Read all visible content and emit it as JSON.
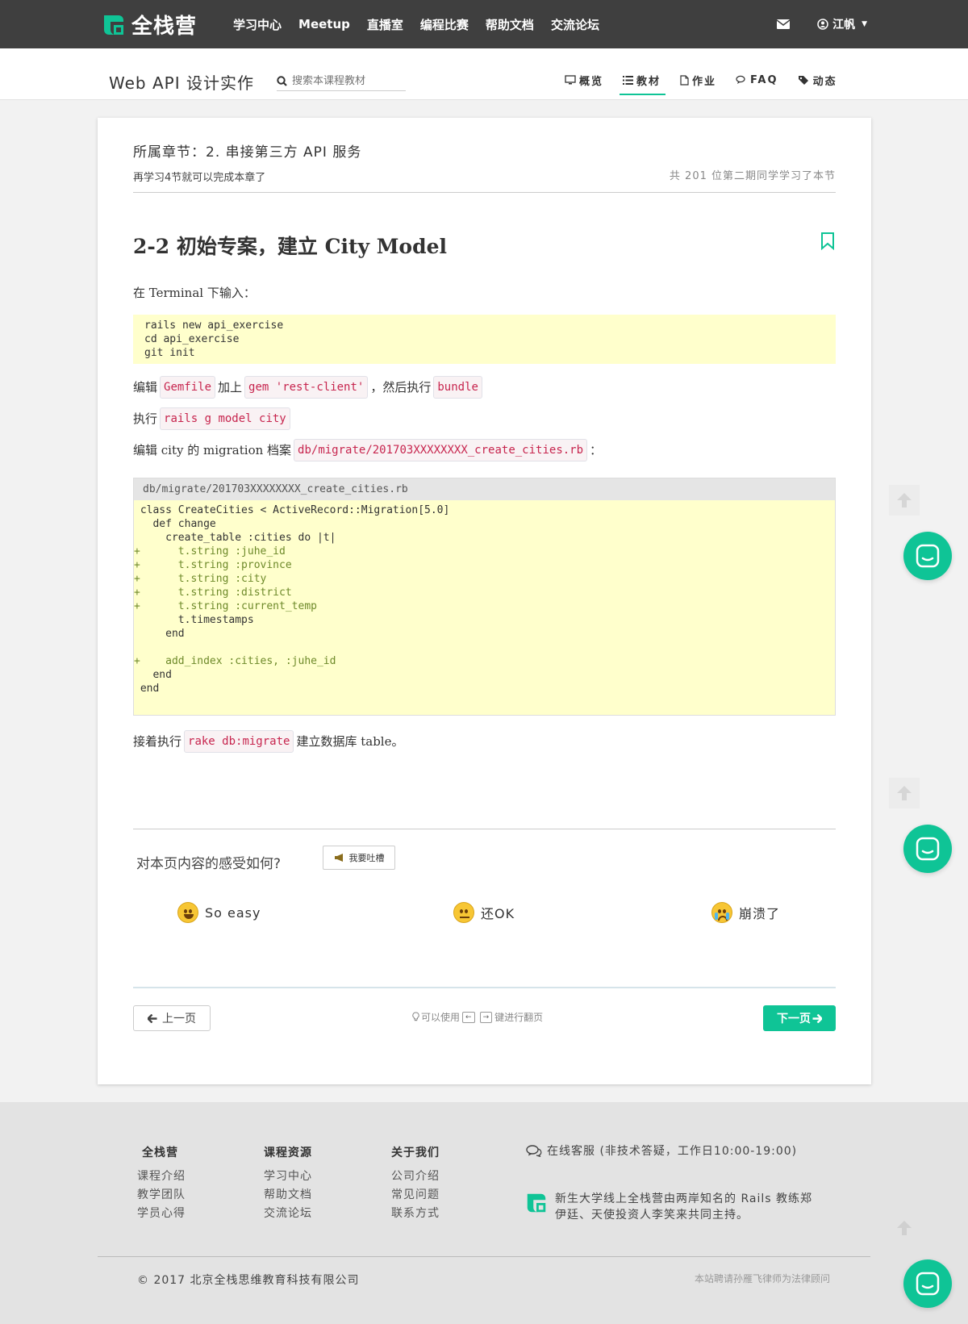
{
  "brand": {
    "name": "全栈营",
    "accent": "#0fc496"
  },
  "topnav": {
    "links": [
      "学习中心",
      "Meetup",
      "直播室",
      "编程比赛",
      "帮助文档",
      "交流论坛"
    ],
    "user_name": "江帆"
  },
  "course": {
    "title": "Web API 设计实作",
    "search_placeholder": "搜索本课程教材",
    "tabs": [
      {
        "label": "概览",
        "icon": "monitor-icon"
      },
      {
        "label": "教材",
        "icon": "list-icon",
        "active": true
      },
      {
        "label": "作业",
        "icon": "document-icon"
      },
      {
        "label": "FAQ",
        "icon": "chat-icon"
      },
      {
        "label": "动态",
        "icon": "tags-icon"
      }
    ]
  },
  "chapter": {
    "label": "所属章节：2. 串接第三方 API 服务",
    "remaining": "再学习4节就可以完成本章了",
    "learners": "共 201 位第二期同学学习了本节"
  },
  "lesson": {
    "title": "2-2 初始专案，建立 City Model",
    "p1": "在 Terminal 下输入：",
    "code1": [
      "rails new api_exercise",
      "cd api_exercise",
      "git init"
    ],
    "p2": {
      "t1": "编辑",
      "c1": "Gemfile",
      "t2": "加上",
      "c2": "gem 'rest-client'",
      "t3": "，然后执行",
      "c3": "bundle"
    },
    "p3": {
      "t1": "执行",
      "c1": "rails g model city"
    },
    "p4": {
      "t1": "编辑 city 的 migration 档案",
      "c1": "db/migrate/201703XXXXXXXX_create_cities.rb",
      "t2": "："
    },
    "code2_filename": "db/migrate/201703XXXXXXXX_create_cities.rb",
    "code2": [
      {
        "text": " class CreateCities < ActiveRecord::Migration[5.0]",
        "add": false
      },
      {
        "text": "   def change",
        "add": false
      },
      {
        "text": "     create_table :cities do |t|",
        "add": false
      },
      {
        "text": "+      t.string :juhe_id",
        "add": true
      },
      {
        "text": "+      t.string :province",
        "add": true
      },
      {
        "text": "+      t.string :city",
        "add": true
      },
      {
        "text": "+      t.string :district",
        "add": true
      },
      {
        "text": "+      t.string :current_temp",
        "add": true
      },
      {
        "text": "       t.timestamps",
        "add": false
      },
      {
        "text": "     end",
        "add": false
      },
      {
        "text": "",
        "add": false
      },
      {
        "text": "+    add_index :cities, :juhe_id",
        "add": true
      },
      {
        "text": "   end",
        "add": false
      },
      {
        "text": " end",
        "add": false
      }
    ],
    "p5": {
      "t1": "接着执行",
      "c1": "rake db:migrate",
      "t2": "建立数据库 table。"
    }
  },
  "feedback": {
    "question": "对本页内容的感受如何?",
    "complain_label": "我要吐槽",
    "reactions": [
      "So easy",
      "还OK",
      "崩溃了"
    ]
  },
  "pager": {
    "prev_label": "上一页",
    "hint_pre": "可以使用",
    "key_left": "←",
    "key_right": "→",
    "hint_post": "键进行翻页",
    "next_label": "下一页"
  },
  "footer": {
    "col1": {
      "title": "全栈营",
      "items": [
        "课程介绍",
        "教学团队",
        "学员心得"
      ]
    },
    "col2": {
      "title": "课程资源",
      "items": [
        "学习中心",
        "帮助文档",
        "交流论坛"
      ]
    },
    "col3": {
      "title": "关于我们",
      "items": [
        "公司介绍",
        "常见问题",
        "联系方式"
      ]
    },
    "service": "在线客服 (非技术答疑，工作日10:00-19:00)",
    "about_line1": "新生大学线上全栈营由两岸知名的 Rails 教练郑",
    "about_line2": "伊廷、天使投资人李笑来共同主持。",
    "copyright": "© 2017 北京全栈思维教育科技有限公司",
    "legal": "本站聘请孙雁飞律师为法律顾问"
  }
}
